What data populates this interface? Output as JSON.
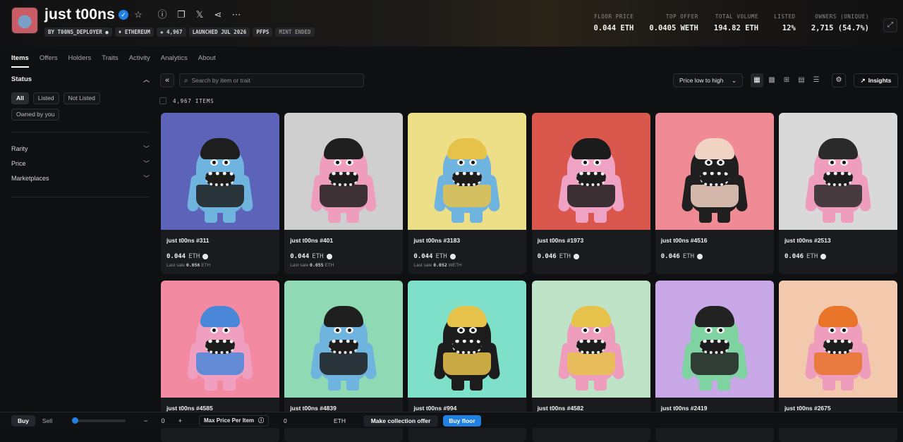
{
  "collection": {
    "title": "just t00ns",
    "badges": [
      "BY T00NS_DEPLOYER",
      "ETHEREUM",
      "4,967",
      "LAUNCHED JUL 2026",
      "PFPS",
      "MINT ENDED"
    ],
    "stats": [
      {
        "label": "FLOOR PRICE",
        "value": "0.044 ETH"
      },
      {
        "label": "TOP OFFER",
        "value": "0.0405 WETH"
      },
      {
        "label": "TOTAL VOLUME",
        "value": "194.82 ETH"
      },
      {
        "label": "LISTED",
        "value": "12%"
      },
      {
        "label": "OWNERS (UNIQUE)",
        "value": "2,715 (54.7%)"
      }
    ]
  },
  "tabs": [
    "Items",
    "Offers",
    "Holders",
    "Traits",
    "Activity",
    "Analytics",
    "About"
  ],
  "sidebar": {
    "status_label": "Status",
    "status_options": [
      "All",
      "Listed",
      "Not Listed",
      "Owned by you"
    ],
    "filters": [
      "Rarity",
      "Price",
      "Marketplaces"
    ]
  },
  "toolbar": {
    "search_placeholder": "Search by item or trait",
    "sort_label": "Price low to high",
    "insights_label": "Insights",
    "count_label": "4,967 ITEMS"
  },
  "items": [
    {
      "name": "just t00ns #311",
      "price": "0.044",
      "currency": "ETH",
      "last_sale_label": "Last sale",
      "last_sale": "0.056",
      "last_sale_currency": "ETH",
      "bg": "#5d63b9",
      "skin": "#6fb4de",
      "accent": "#1e1e1e"
    },
    {
      "name": "just t00ns #401",
      "price": "0.044",
      "currency": "ETH",
      "last_sale_label": "Last sale",
      "last_sale": "0.055",
      "last_sale_currency": "ETH",
      "bg": "#cfcfcf",
      "skin": "#ef9dbd",
      "accent": "#1f1f1f"
    },
    {
      "name": "just t00ns #3183",
      "price": "0.044",
      "currency": "ETH",
      "last_sale_label": "Last sale",
      "last_sale": "0.052",
      "last_sale_currency": "WETH",
      "bg": "#ecdf88",
      "skin": "#6fb4de",
      "accent": "#e6c24a"
    },
    {
      "name": "just t00ns #1973",
      "price": "0.046",
      "currency": "ETH",
      "last_sale_label": "",
      "last_sale": "",
      "last_sale_currency": "",
      "bg": "#d9574d",
      "skin": "#efa2c4",
      "accent": "#1b1b1b"
    },
    {
      "name": "just t00ns #4516",
      "price": "0.046",
      "currency": "ETH",
      "last_sale_label": "",
      "last_sale": "",
      "last_sale_currency": "",
      "bg": "#f08a94",
      "skin": "#1f1f1f",
      "accent": "#f2d2c3"
    },
    {
      "name": "just t00ns #2513",
      "price": "0.046",
      "currency": "ETH",
      "last_sale_label": "",
      "last_sale": "",
      "last_sale_currency": "",
      "bg": "#d9d9d9",
      "skin": "#ef9dbd",
      "accent": "#2a2a2a"
    },
    {
      "name": "just t00ns #4585",
      "price": "",
      "currency": "",
      "last_sale_label": "",
      "last_sale": "",
      "last_sale_currency": "",
      "bg": "#f28aa2",
      "skin": "#f09fc0",
      "accent": "#4a87d8"
    },
    {
      "name": "just t00ns #4839",
      "price": "",
      "currency": "",
      "last_sale_label": "",
      "last_sale": "",
      "last_sale_currency": "",
      "bg": "#8fd9b4",
      "skin": "#6fb4de",
      "accent": "#1f1f1f"
    },
    {
      "name": "just t00ns #994",
      "price": "",
      "currency": "",
      "last_sale_label": "",
      "last_sale": "",
      "last_sale_currency": "",
      "bg": "#7fe0c9",
      "skin": "#1c1c1c",
      "accent": "#e6c24a"
    },
    {
      "name": "just t00ns #4582",
      "price": "",
      "currency": "",
      "last_sale_label": "",
      "last_sale": "",
      "last_sale_currency": "",
      "bg": "#bfe3c7",
      "skin": "#ef9dbd",
      "accent": "#e6c24a"
    },
    {
      "name": "just t00ns #2419",
      "price": "",
      "currency": "",
      "last_sale_label": "",
      "last_sale": "",
      "last_sale_currency": "",
      "bg": "#c8a8e6",
      "skin": "#7ed3a1",
      "accent": "#222222"
    },
    {
      "name": "just t00ns #2675",
      "price": "",
      "currency": "",
      "last_sale_label": "",
      "last_sale": "",
      "last_sale_currency": "",
      "bg": "#f3c9ad",
      "skin": "#ef9dbd",
      "accent": "#e8752a"
    }
  ],
  "bottombar": {
    "buy_label": "Buy",
    "sell_label": "Sell",
    "quantity": "0",
    "max_price_label": "Max Price Per Item",
    "max_price_value": "0",
    "max_price_currency": "ETH",
    "offer_label": "Make collection offer",
    "floor_label": "Buy floor"
  }
}
